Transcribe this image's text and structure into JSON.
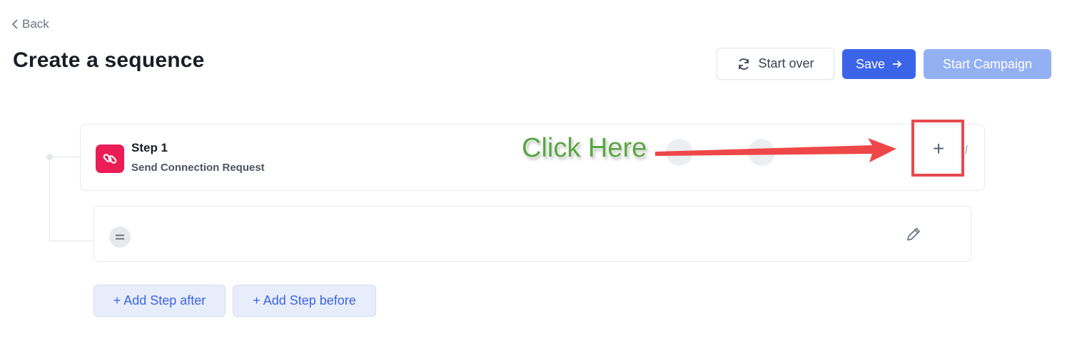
{
  "nav": {
    "back_label": "Back"
  },
  "header": {
    "title": "Create a sequence"
  },
  "actions": {
    "start_over_label": "Start over",
    "save_label": "Save",
    "start_campaign_label": "Start Campaign"
  },
  "steps": [
    {
      "title": "Step 1",
      "subtitle": "Send Connection Request",
      "icon": "link-icon"
    }
  ],
  "annotation": {
    "callout_text": "Click Here",
    "color": "#5aa543",
    "highlight_color": "#e84a4e"
  },
  "add_buttons": {
    "after_label": "+ Add Step after",
    "before_label": "+ Add Step before"
  },
  "colors": {
    "primary": "#3b64e8",
    "primary_disabled": "#93b0f3",
    "step_icon_bg": "#ea1d54"
  }
}
